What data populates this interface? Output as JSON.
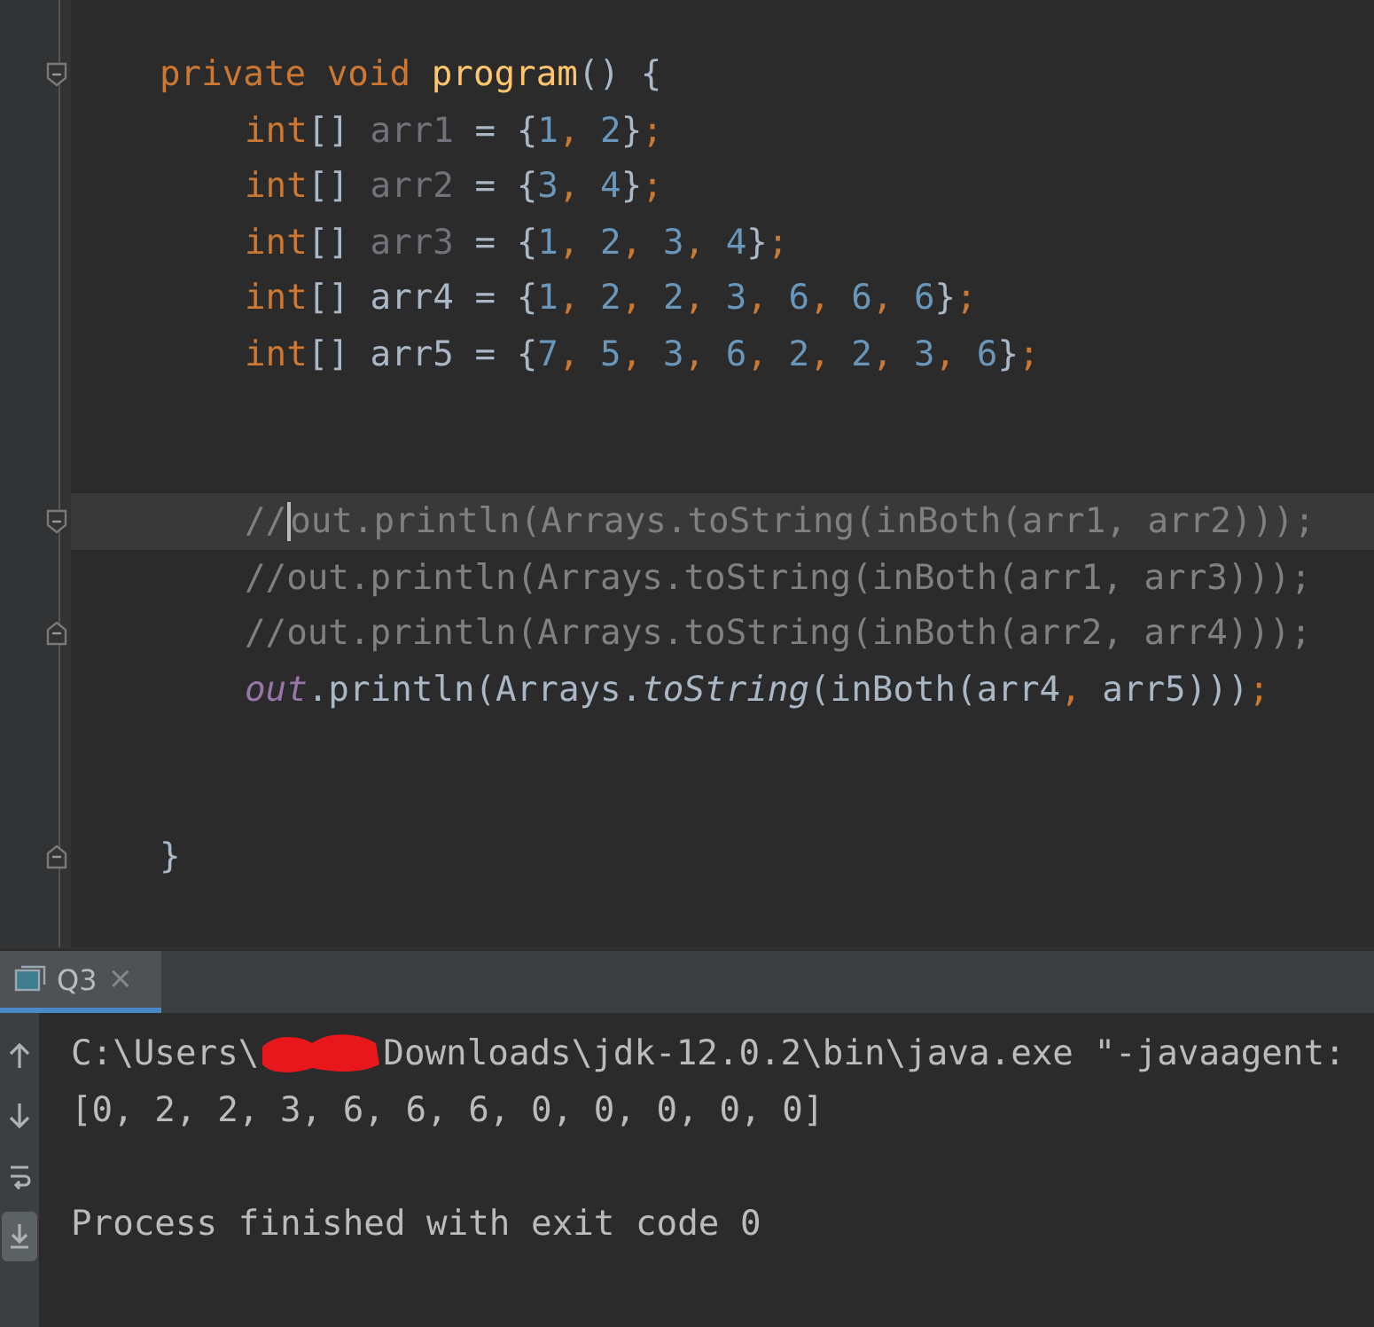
{
  "editor": {
    "lines": [
      {
        "kind": "code",
        "fold_start": true,
        "tokens": [
          {
            "kind": "keyword",
            "text": "private void "
          },
          {
            "kind": "function",
            "text": "program"
          },
          {
            "kind": "plain",
            "text": "() {"
          }
        ],
        "children": [
          {
            "kind": "code",
            "tokens": [
              {
                "kind": "keyword",
                "text": "int"
              },
              {
                "kind": "plain",
                "text": "[] "
              },
              {
                "kind": "unused",
                "text": "arr1"
              },
              {
                "kind": "plain",
                "text": " = {"
              },
              {
                "kind": "number",
                "text": "1"
              },
              {
                "kind": "punct",
                "text": ", "
              },
              {
                "kind": "number",
                "text": "2"
              },
              {
                "kind": "plain",
                "text": "}"
              },
              {
                "kind": "punct",
                "text": ";"
              }
            ]
          },
          {
            "kind": "code",
            "tokens": [
              {
                "kind": "keyword",
                "text": "int"
              },
              {
                "kind": "plain",
                "text": "[] "
              },
              {
                "kind": "unused",
                "text": "arr2"
              },
              {
                "kind": "plain",
                "text": " = {"
              },
              {
                "kind": "number",
                "text": "3"
              },
              {
                "kind": "punct",
                "text": ", "
              },
              {
                "kind": "number",
                "text": "4"
              },
              {
                "kind": "plain",
                "text": "}"
              },
              {
                "kind": "punct",
                "text": ";"
              }
            ]
          },
          {
            "kind": "code",
            "tokens": [
              {
                "kind": "keyword",
                "text": "int"
              },
              {
                "kind": "plain",
                "text": "[] "
              },
              {
                "kind": "unused",
                "text": "arr3"
              },
              {
                "kind": "plain",
                "text": " = {"
              },
              {
                "kind": "number",
                "text": "1"
              },
              {
                "kind": "punct",
                "text": ", "
              },
              {
                "kind": "number",
                "text": "2"
              },
              {
                "kind": "punct",
                "text": ", "
              },
              {
                "kind": "number",
                "text": "3"
              },
              {
                "kind": "punct",
                "text": ", "
              },
              {
                "kind": "number",
                "text": "4"
              },
              {
                "kind": "plain",
                "text": "}"
              },
              {
                "kind": "punct",
                "text": ";"
              }
            ]
          },
          {
            "kind": "code",
            "tokens": [
              {
                "kind": "keyword",
                "text": "int"
              },
              {
                "kind": "plain",
                "text": "[] arr4 = {"
              },
              {
                "kind": "number",
                "text": "1"
              },
              {
                "kind": "punct",
                "text": ", "
              },
              {
                "kind": "number",
                "text": "2"
              },
              {
                "kind": "punct",
                "text": ", "
              },
              {
                "kind": "number",
                "text": "2"
              },
              {
                "kind": "punct",
                "text": ", "
              },
              {
                "kind": "number",
                "text": "3"
              },
              {
                "kind": "punct",
                "text": ", "
              },
              {
                "kind": "number",
                "text": "6"
              },
              {
                "kind": "punct",
                "text": ", "
              },
              {
                "kind": "number",
                "text": "6"
              },
              {
                "kind": "punct",
                "text": ", "
              },
              {
                "kind": "number",
                "text": "6"
              },
              {
                "kind": "plain",
                "text": "}"
              },
              {
                "kind": "punct",
                "text": ";"
              }
            ]
          },
          {
            "kind": "code",
            "tokens": [
              {
                "kind": "keyword",
                "text": "int"
              },
              {
                "kind": "plain",
                "text": "[] arr5 = {"
              },
              {
                "kind": "number",
                "text": "7"
              },
              {
                "kind": "punct",
                "text": ", "
              },
              {
                "kind": "number",
                "text": "5"
              },
              {
                "kind": "punct",
                "text": ", "
              },
              {
                "kind": "number",
                "text": "3"
              },
              {
                "kind": "punct",
                "text": ", "
              },
              {
                "kind": "number",
                "text": "6"
              },
              {
                "kind": "punct",
                "text": ", "
              },
              {
                "kind": "number",
                "text": "2"
              },
              {
                "kind": "punct",
                "text": ", "
              },
              {
                "kind": "number",
                "text": "2"
              },
              {
                "kind": "punct",
                "text": ", "
              },
              {
                "kind": "number",
                "text": "3"
              },
              {
                "kind": "punct",
                "text": ", "
              },
              {
                "kind": "number",
                "text": "6"
              },
              {
                "kind": "plain",
                "text": "}"
              },
              {
                "kind": "punct",
                "text": ";"
              }
            ]
          },
          {
            "kind": "blank"
          },
          {
            "kind": "blank"
          },
          {
            "kind": "code",
            "current": true,
            "fold_start": true,
            "tokens": [
              {
                "kind": "comment",
                "text": "//",
                "caret": true
              },
              {
                "kind": "comment",
                "text": "out.println(Arrays.toString(inBoth(arr1, arr2)));"
              }
            ]
          },
          {
            "kind": "code",
            "tokens": [
              {
                "kind": "comment",
                "text": "//out.println(Arrays.toString(inBoth(arr1, arr3)));"
              }
            ]
          },
          {
            "kind": "code",
            "fold_end": true,
            "tokens": [
              {
                "kind": "comment",
                "text": "//out.println(Arrays.toString(inBoth(arr2, arr4)));"
              }
            ]
          },
          {
            "kind": "code",
            "tokens": [
              {
                "kind": "field",
                "text": "out"
              },
              {
                "kind": "plain",
                "text": ".println(Arrays."
              },
              {
                "kind": "italic",
                "text": "toString"
              },
              {
                "kind": "plain",
                "text": "(inBoth(arr4"
              },
              {
                "kind": "punct",
                "text": ", "
              },
              {
                "kind": "plain",
                "text": "arr5)))"
              },
              {
                "kind": "punct",
                "text": ";"
              }
            ]
          },
          {
            "kind": "blank"
          },
          {
            "kind": "blank"
          }
        ]
      },
      {
        "kind": "code",
        "fold_end": true,
        "tokens": [
          {
            "kind": "plain",
            "text": "}"
          }
        ]
      }
    ]
  },
  "console": {
    "tabs": [
      {
        "label": "Q3",
        "selected": true,
        "close": "×"
      }
    ],
    "toolbar": [
      {
        "kind": "up",
        "selected": false
      },
      {
        "kind": "down",
        "selected": false
      },
      {
        "kind": "wrap",
        "selected": false
      },
      {
        "kind": "scroll-end",
        "selected": true
      }
    ],
    "lines": [
      {
        "kind": "text",
        "segments": [
          {
            "kind": "text",
            "text": "C:\\Users\\"
          },
          {
            "kind": "redaction"
          },
          {
            "kind": "text",
            "text": "Downloads\\jdk-12.0.2\\bin\\java.exe \"-javaagent:"
          }
        ]
      },
      {
        "kind": "text",
        "segments": [
          {
            "kind": "text",
            "text": "[0, 2, 2, 3, 6, 6, 6, 0, 0, 0, 0, 0]"
          }
        ]
      },
      {
        "kind": "blank"
      },
      {
        "kind": "text",
        "segments": [
          {
            "kind": "text",
            "text": "Process finished with exit code 0"
          }
        ]
      }
    ]
  }
}
